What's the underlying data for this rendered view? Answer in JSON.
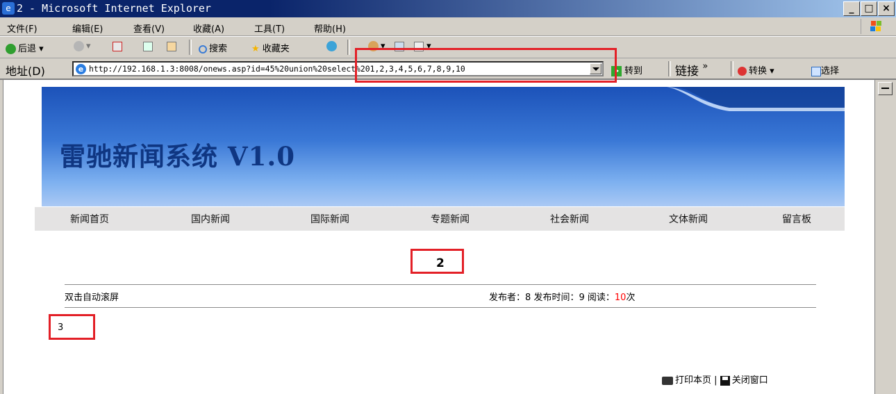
{
  "window": {
    "title": "2 - Microsoft Internet Explorer",
    "minimize_glyph": "_",
    "maximize_glyph": "□",
    "close_glyph": "×"
  },
  "menu": [
    "文件(F)",
    "编辑(E)",
    "查看(V)",
    "收藏(A)",
    "工具(T)",
    "帮助(H)"
  ],
  "toolbar": {
    "back": "后退",
    "search": "搜索",
    "favorites": "收藏夹"
  },
  "address": {
    "label": "地址(D)",
    "url": "http://192.168.1.3:8008/onews.asp?id=45%20union%20select%201,2,3,4,5,6,7,8,9,10",
    "go": "转到",
    "links": "链接",
    "links_more": "»",
    "convert": "转换",
    "select": "选择"
  },
  "site": {
    "banner_title": "雷驰新闻系统 V1.0",
    "nav": [
      "新闻首页",
      "国内新闻",
      "国际新闻",
      "专题新闻",
      "社会新闻",
      "文体新闻",
      "留言板"
    ]
  },
  "article": {
    "title": "2",
    "autoscroll": "双击自动滚屏",
    "publisher_label": "发布者：",
    "publisher": "8",
    "time_label": "发布时间：",
    "time": "9",
    "read_label": "阅读：",
    "reads": "10",
    "reads_suffix": "次",
    "body": "3",
    "print": "打印本页",
    "divider": "|",
    "close": "关闭窗口"
  },
  "colors": {
    "highlight_box": "#e32027",
    "banner_title": "#0f3682",
    "read_count": "#ff0000"
  }
}
